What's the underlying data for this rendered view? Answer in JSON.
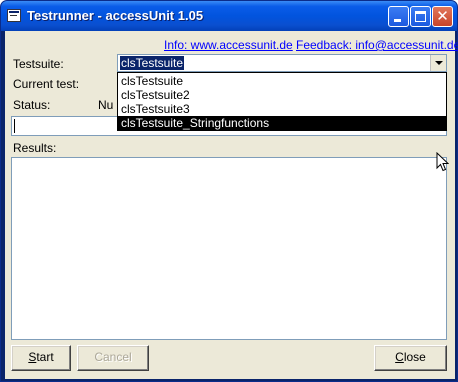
{
  "window": {
    "title": "Testrunner - accessUnit 1.05",
    "close_glyph": "✕"
  },
  "links": {
    "info": "Info: www.accessunit.de",
    "feedback": "Feedback: info@accessunit.de"
  },
  "form": {
    "testsuite_label": "Testsuite:",
    "testsuite_value": "clsTestsuite",
    "current_test_label": "Current test:",
    "status_label": "Status:",
    "status_value": "Nu",
    "results_label": "Results:"
  },
  "dropdown": {
    "options": [
      "clsTestsuite",
      "clsTestsuite2",
      "clsTestsuite3",
      "clsTestsuite_Stringfunctions"
    ]
  },
  "buttons": {
    "start_mnemonic": "S",
    "start_rest": "tart",
    "cancel": "Cancel",
    "close_mnemonic": "C",
    "close_rest": "lose"
  },
  "colors": {
    "titlebar": "#0054e3",
    "face": "#ece9d8",
    "selection": "#0a246a"
  }
}
